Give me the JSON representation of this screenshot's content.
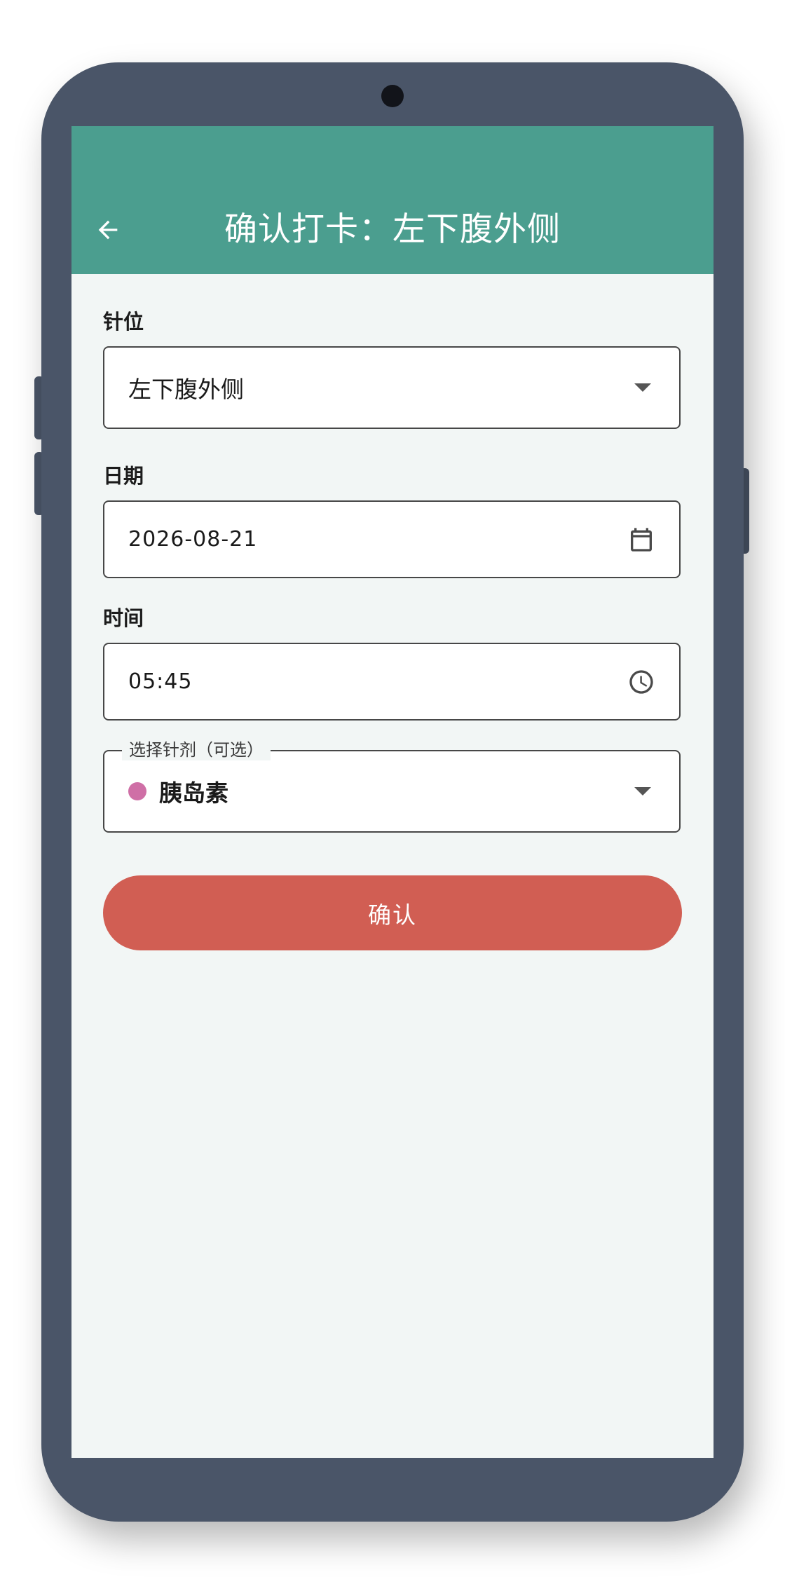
{
  "colors": {
    "app_bar": "#4b9e8f",
    "screen_bg": "#f2f6f5",
    "confirm_button": "#d15e53",
    "phone_frame": "#4a5568",
    "medication_dot": "#cf6fa6"
  },
  "header": {
    "title": "确认打卡：左下腹外侧",
    "back_icon": "arrow-left-icon"
  },
  "form": {
    "site": {
      "label": "针位",
      "value": "左下腹外侧",
      "icon": "dropdown-arrow-icon"
    },
    "date": {
      "label": "日期",
      "value": "2026-08-21",
      "icon": "calendar-icon"
    },
    "time": {
      "label": "时间",
      "value": "05:45",
      "icon": "clock-icon"
    },
    "medication": {
      "label": "选择针剂（可选）",
      "value": "胰岛素",
      "icon": "dropdown-arrow-icon"
    }
  },
  "actions": {
    "confirm_label": "确认"
  }
}
